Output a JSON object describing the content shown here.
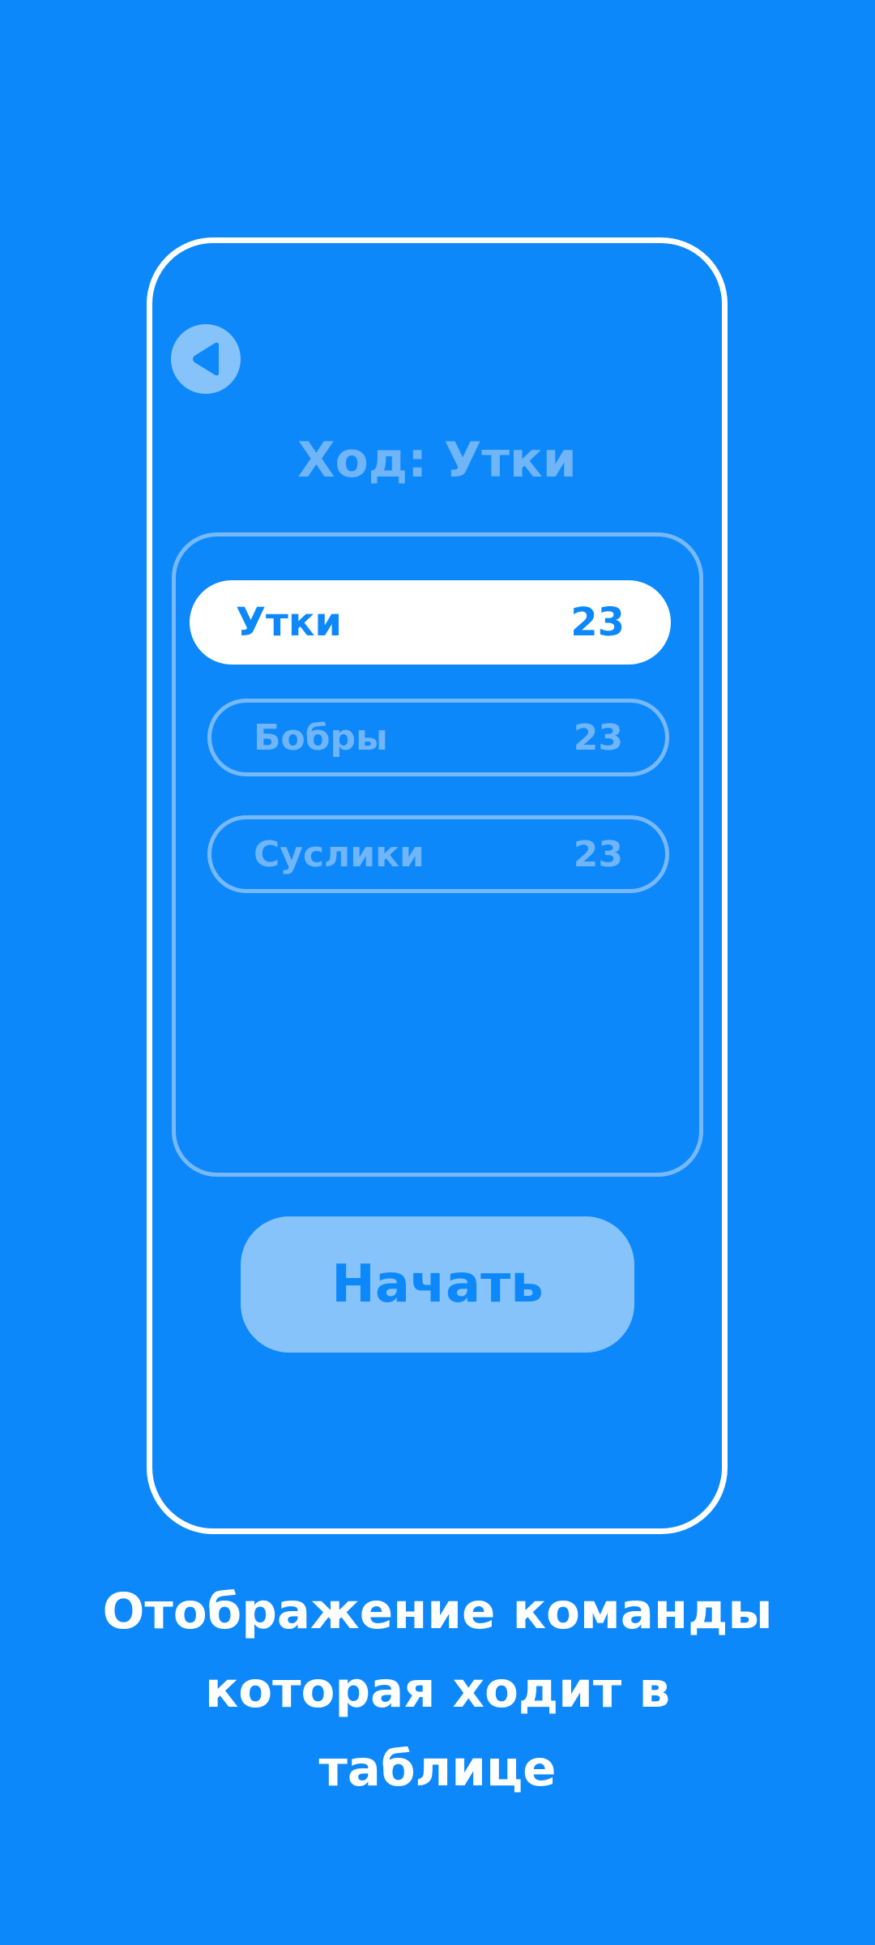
{
  "colors": {
    "background": "#0D88FA",
    "frame": "#FFFFFF",
    "muted": "#87C3FB",
    "muted_text": "#6FB5F8"
  },
  "header": {
    "back_icon": "play-back-icon",
    "title": "Ход: Утки"
  },
  "teams": [
    {
      "name": "Утки",
      "score": "23",
      "active": true
    },
    {
      "name": "Бобры",
      "score": "23",
      "active": false
    },
    {
      "name": "Суслики",
      "score": "23",
      "active": false
    }
  ],
  "start_button": {
    "label": "Начать"
  },
  "caption": {
    "line1": "Отображение команды",
    "line2": "которая ходит в",
    "line3": "таблице"
  }
}
